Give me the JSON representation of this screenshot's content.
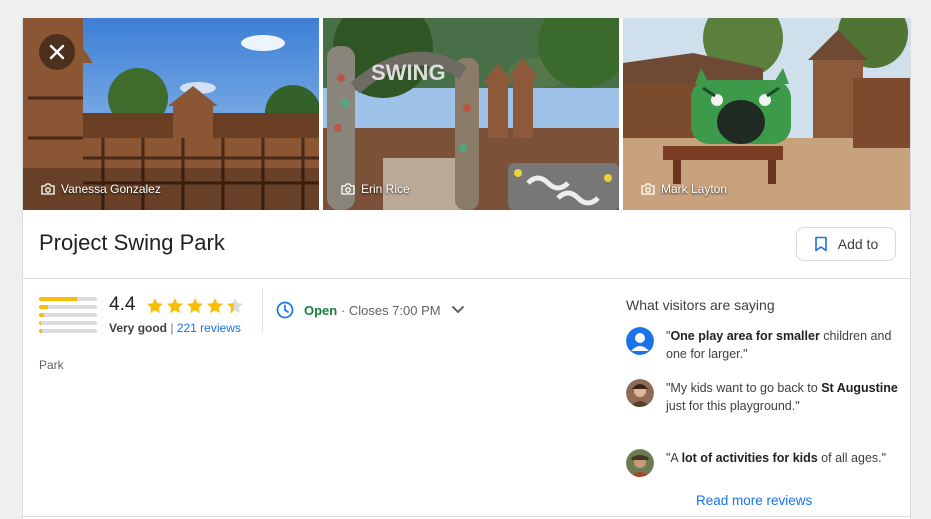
{
  "photos": [
    {
      "credit": "Vanessa Gonzalez"
    },
    {
      "credit": "Erin Rice"
    },
    {
      "credit": "Mark Layton"
    }
  ],
  "place": {
    "title": "Project Swing Park",
    "save_label": "Add to",
    "category": "Park"
  },
  "rating": {
    "score": "4.4",
    "verdict": "Very good",
    "separator": "|",
    "reviews_label": "221 reviews",
    "stars_fraction": 0.88,
    "distribution": [
      0.65,
      0.15,
      0.08,
      0.04,
      0.06
    ],
    "bar_color": "#fbbc04"
  },
  "hours": {
    "status": "Open",
    "separator": "·",
    "closes": "Closes 7:00 PM"
  },
  "visitors": {
    "title": "What visitors are saying",
    "quotes": [
      {
        "q1": "\"",
        "bold1": "One play area for smaller",
        "t2": " children and one for larger.\""
      },
      {
        "q1": "\"My kids want to go back to ",
        "bold1": "St Augustine",
        "t2": " just for this playground.\""
      },
      {
        "q1": "\"A ",
        "bold1": "lot of activities for kids",
        "t2": " of all ages.\""
      }
    ],
    "more_label": "Read more reviews"
  },
  "colors": {
    "accent": "#1a73e8",
    "open": "#188038",
    "star": "#fbbc04"
  }
}
